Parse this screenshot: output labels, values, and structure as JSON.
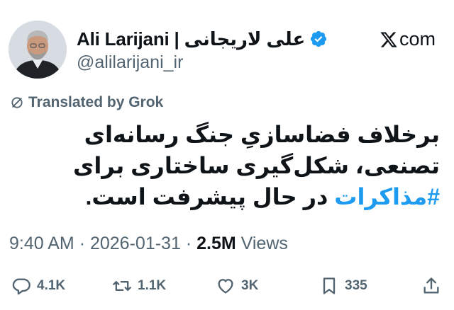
{
  "author": {
    "display_name": "Ali Larijani | علی لاریجانی",
    "handle": "@alilarijani_ir",
    "verified_icon": "verified-badge-icon"
  },
  "brand": {
    "logo_text": "com",
    "icon": "x-logo-icon"
  },
  "translation": {
    "label": "Translated by Grok",
    "icon": "translate-icon"
  },
  "post": {
    "text_before": "برخلاف فضاسازیِ جنگ رسانه‌ای تصنعی، شکل‌گیری ساختاری برای ",
    "hashtag": "#مذاکرات",
    "text_after": " در حال پیشرفت است."
  },
  "meta": {
    "time": "9:40 AM",
    "separator": "·",
    "date": "2026-01-31",
    "views_count": "2.5M",
    "views_label": "Views"
  },
  "actions": {
    "replies": "4.1K",
    "reposts": "1.1K",
    "likes": "3K",
    "bookmarks": "335"
  },
  "colors": {
    "accent": "#1d9bf0",
    "muted": "#536471",
    "text": "#0f1419"
  }
}
